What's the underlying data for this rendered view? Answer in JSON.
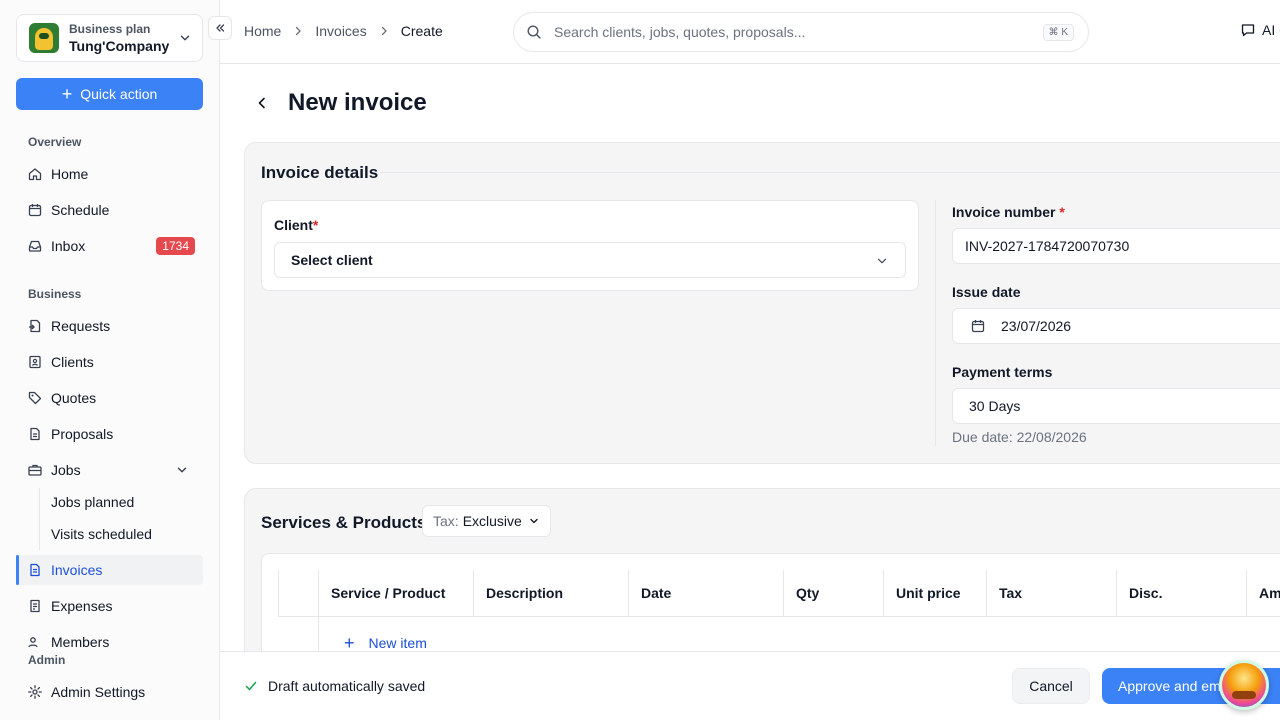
{
  "workspace": {
    "plan": "Business plan",
    "name": "Tung'Company"
  },
  "quick_action": "Quick action",
  "sections": {
    "overview": "Overview",
    "business": "Business",
    "admin": "Admin"
  },
  "nav": {
    "home": "Home",
    "schedule": "Schedule",
    "inbox": "Inbox",
    "inbox_count": "1734",
    "requests": "Requests",
    "clients": "Clients",
    "quotes": "Quotes",
    "proposals": "Proposals",
    "jobs": "Jobs",
    "jobs_planned": "Jobs planned",
    "visits_scheduled": "Visits scheduled",
    "invoices": "Invoices",
    "expenses": "Expenses",
    "members": "Members",
    "admin_settings": "Admin Settings"
  },
  "breadcrumb": [
    "Home",
    "Invoices",
    "Create"
  ],
  "search": {
    "placeholder": "Search clients, jobs, quotes, proposals...",
    "shortcut": "⌘ K"
  },
  "ai_chat": "AI Chat",
  "page_title": "New invoice",
  "invoice_details": {
    "title": "Invoice details",
    "client_label": "Client",
    "client_required": "*",
    "client_value": "Select client",
    "invoice_number_label": "Invoice number",
    "invoice_number_required": "*",
    "invoice_number": "INV-2027-1784720070730",
    "issue_date_label": "Issue date",
    "issue_date": "23/07/2026",
    "payment_terms_label": "Payment terms",
    "payment_terms": "30 Days",
    "due_date": "Due date: 22/08/2026"
  },
  "services": {
    "title": "Services & Products",
    "tax_label": "Tax:",
    "tax_value": "Exclusive",
    "columns": [
      "Service / Product",
      "Description",
      "Date",
      "Qty",
      "Unit price",
      "Tax",
      "Disc.",
      "Amount"
    ],
    "new_item": "New item"
  },
  "footer": {
    "draft_status": "Draft automatically saved",
    "cancel": "Cancel",
    "approve": "Approve and email"
  },
  "colors": {
    "accent": "#3b82f6",
    "badge": "#e5484d",
    "active_text": "#1d4ed8"
  }
}
